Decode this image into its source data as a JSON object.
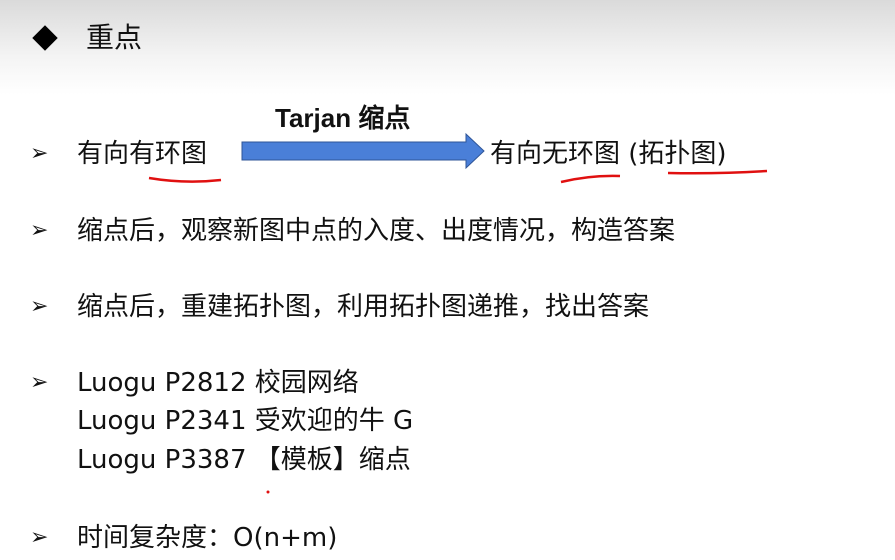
{
  "title": "重点",
  "bullets": [
    {
      "left": "有向有环图",
      "arrow_label": "Tarjan 缩点",
      "right": "有向无环图 (拓扑图)"
    },
    {
      "text": "缩点后，观察新图中点的入度、出度情况，构造答案"
    },
    {
      "text": "缩点后，重建拓扑图，利用拓扑图递推，找出答案"
    },
    {
      "lines": [
        "Luogu P2812 校园网络",
        "Luogu P2341 受欢迎的牛 G",
        "Luogu P3387 【模板】缩点"
      ]
    },
    {
      "text": "时间复杂度：O(n+m)"
    }
  ],
  "colors": {
    "arrow": "#4a7fd8",
    "annotation": "#e01010"
  }
}
